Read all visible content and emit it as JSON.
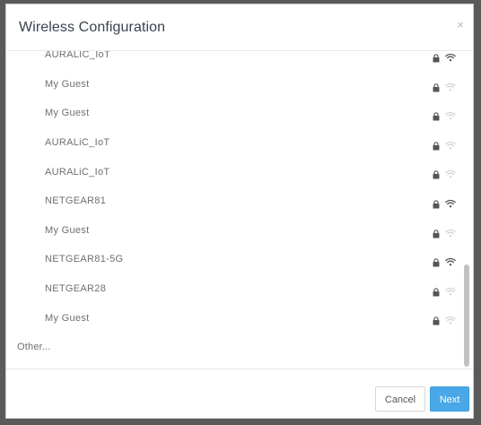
{
  "dialog": {
    "title": "Wireless Configuration",
    "close_glyph": "×"
  },
  "networks": [
    {
      "name": "AURALIC_IoT",
      "locked": true,
      "signal": "strong"
    },
    {
      "name": "My Guest",
      "locked": true,
      "signal": "weak"
    },
    {
      "name": "My Guest",
      "locked": true,
      "signal": "weak"
    },
    {
      "name": "AURALiC_IoT",
      "locked": true,
      "signal": "weak"
    },
    {
      "name": "AURALiC_IoT",
      "locked": true,
      "signal": "weak"
    },
    {
      "name": "NETGEAR81",
      "locked": true,
      "signal": "strong"
    },
    {
      "name": "My Guest",
      "locked": true,
      "signal": "weak"
    },
    {
      "name": "NETGEAR81-5G",
      "locked": true,
      "signal": "strong"
    },
    {
      "name": "NETGEAR28",
      "locked": true,
      "signal": "weak"
    },
    {
      "name": "My Guest",
      "locked": true,
      "signal": "weak"
    }
  ],
  "other_label": "Other...",
  "footer": {
    "cancel_label": "Cancel",
    "next_label": "Next"
  },
  "colors": {
    "accent": "#4aa8e8",
    "icon_strong": "#555555",
    "icon_weak": "#d5d5d5",
    "lock": "#555555"
  },
  "icons": {
    "lock": "lock-icon",
    "wifi": "wifi-icon",
    "close": "close-icon"
  }
}
